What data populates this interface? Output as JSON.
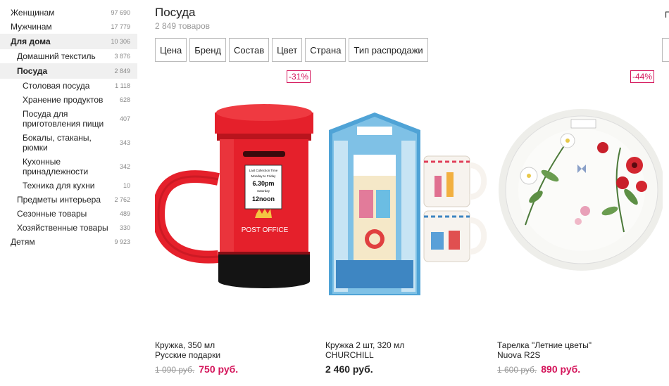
{
  "sidebar": {
    "women": {
      "label": "Женщинам",
      "count": "97 690"
    },
    "men": {
      "label": "Мужчинам",
      "count": "17 779"
    },
    "home": {
      "label": "Для дома",
      "count": "10 306"
    },
    "textile": {
      "label": "Домашний текстиль",
      "count": "3 876"
    },
    "dishes": {
      "label": "Посуда",
      "count": "2 849"
    },
    "tableware": {
      "label": "Столовая посуда",
      "count": "1 118"
    },
    "storage": {
      "label": "Хранение продуктов",
      "count": "628"
    },
    "cookware": {
      "label": "Посуда для приготовления пищи",
      "count": "407"
    },
    "glasses": {
      "label": "Бокалы, стаканы, рюмки",
      "count": "343"
    },
    "kitchen_tools": {
      "label": "Кухонные принадлежности",
      "count": "342"
    },
    "appliances": {
      "label": "Техника для кухни",
      "count": "10"
    },
    "interior": {
      "label": "Предметы интерьера",
      "count": "2 762"
    },
    "seasonal": {
      "label": "Сезонные товары",
      "count": "489"
    },
    "household": {
      "label": "Хозяйственные товары",
      "count": "330"
    },
    "kids": {
      "label": "Детям",
      "count": "9 923"
    }
  },
  "header": {
    "title": "Посуда",
    "subtitle": "2 849 товаров",
    "edge_letter": "П"
  },
  "filters": {
    "price": "Цена",
    "brand": "Бренд",
    "material": "Состав",
    "color": "Цвет",
    "country": "Страна",
    "sale_type": "Тип распродажи"
  },
  "products": {
    "p1": {
      "badge": "-31%",
      "name": "Кружка, 350 мл",
      "brand": "Русские подарки",
      "old_price": "1 090 руб.",
      "price": "750 руб."
    },
    "p2": {
      "name": "Кружка 2 шт, 320 мл",
      "brand": "CHURCHILL",
      "price": "2 460 руб."
    },
    "p3": {
      "badge": "-44%",
      "name": "Тарелка \"Летние цветы\"",
      "brand": "Nuova R2S",
      "old_price": "1 600 руб.",
      "price": "890 руб."
    }
  },
  "mug_text": {
    "label_line1": "Last Collection Time",
    "label_line2": "Monday to Friday",
    "label_time1": "6.30pm",
    "label_line3": "Saturday",
    "label_time2": "12noon",
    "post_office": "POST OFFICE"
  },
  "colors": {
    "accent": "#d4145a",
    "mug_red": "#e5202b"
  }
}
